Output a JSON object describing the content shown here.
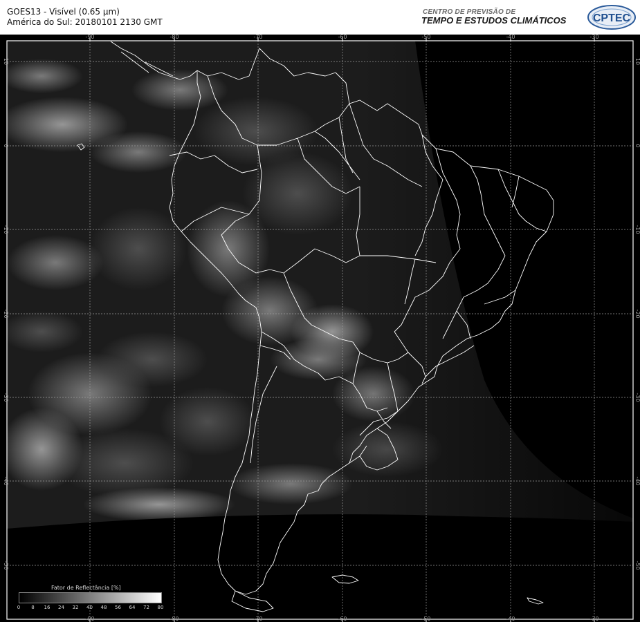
{
  "header": {
    "title_line1": "GOES13 - Visível (0.65 µm)",
    "title_line2": "América do Sul: 20180101 2130 GMT",
    "org_line1": "CENTRO DE PREVISÃO DE",
    "org_line2": "TEMPO E ESTUDOS CLIMÁTICOS",
    "logo_text": "CPTEC"
  },
  "map": {
    "longitude_labels": [
      "-90",
      "-80",
      "-70",
      "-60",
      "-50",
      "-40",
      "-30"
    ],
    "latitude_labels": [
      "10",
      "0",
      "-10",
      "-20",
      "-30",
      "-40",
      "-50"
    ],
    "colors": {
      "background": "#000000",
      "coastline": "#ffffff",
      "grid": "#b0b0b0",
      "frame": "#ffffff"
    }
  },
  "legend": {
    "title": "Fator de Reflectância [%]",
    "ticks": [
      "0",
      "8",
      "16",
      "24",
      "32",
      "40",
      "48",
      "56",
      "64",
      "72",
      "80"
    ]
  }
}
